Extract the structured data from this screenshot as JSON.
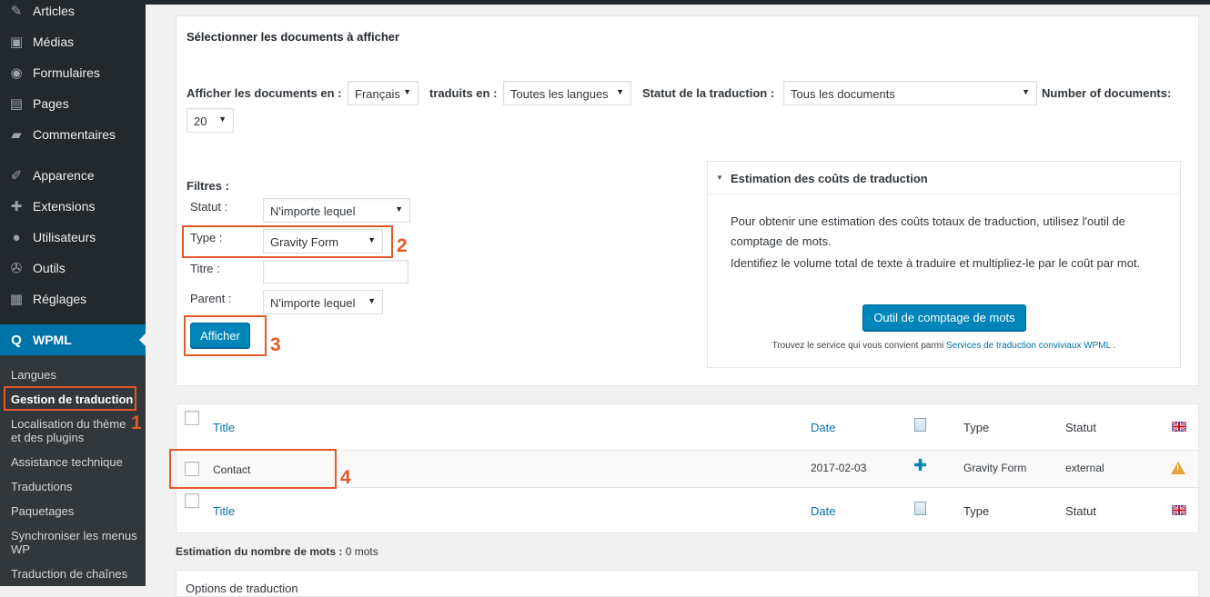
{
  "sidebar": {
    "items": [
      {
        "label": "Articles",
        "icon": "pin-icon"
      },
      {
        "label": "Médias",
        "icon": "media-icon"
      },
      {
        "label": "Formulaires",
        "icon": "forms-icon"
      },
      {
        "label": "Pages",
        "icon": "pages-icon"
      },
      {
        "label": "Commentaires",
        "icon": "comments-icon"
      },
      {
        "label": "Apparence",
        "icon": "brush-icon"
      },
      {
        "label": "Extensions",
        "icon": "plugins-icon"
      },
      {
        "label": "Utilisateurs",
        "icon": "users-icon"
      },
      {
        "label": "Outils",
        "icon": "tools-icon"
      },
      {
        "label": "Réglages",
        "icon": "settings-icon"
      }
    ],
    "active": {
      "label": "WPML",
      "icon": "wpml-icon"
    },
    "submenu": [
      "Langues",
      "Gestion de traduction",
      "Localisation du thème et des plugins",
      "Assistance technique",
      "Traductions",
      "Paquetages",
      "Synchroniser les menus WP",
      "Traduction de chaînes"
    ]
  },
  "annotations": [
    "1",
    "2",
    "3",
    "4"
  ],
  "filters": {
    "section_title": "Sélectionner les documents à afficher",
    "show_docs_label": "Afficher les documents en :",
    "show_docs_value": "Français",
    "translated_label": "traduits en :",
    "translated_value": "Toutes les langues",
    "status_label": "Statut de la traduction :",
    "status_value": "Tous les documents",
    "number_label": "Number of documents:",
    "number_value": "20",
    "filters_label": "Filtres :",
    "statut_label": "Statut :",
    "statut_value": "N'importe lequel",
    "type_label": "Type :",
    "type_value": "Gravity Form",
    "titre_label": "Titre :",
    "titre_value": "",
    "parent_label": "Parent :",
    "parent_value": "N'importe lequel",
    "submit_label": "Afficher"
  },
  "estimate": {
    "title": "Estimation des coûts de traduction",
    "p1": "Pour obtenir une estimation des coûts totaux de traduction, utilisez l'outil de comptage de mots.",
    "p2": "Identifiez le volume total de texte à traduire et multipliez-le par le coût par mot.",
    "button_label": "Outil de comptage de mots",
    "footer_text": "Trouvez le service qui vous convient parmi",
    "footer_link": "Services de traduction conviviaux WPML",
    "footer_end": "."
  },
  "table": {
    "columns": {
      "title": "Title",
      "date": "Date",
      "type": "Type",
      "status": "Statut"
    },
    "rows": [
      {
        "title": "Contact",
        "date": "2017-02-03",
        "type": "Gravity Form",
        "status": "external"
      }
    ]
  },
  "word_count": {
    "label": "Estimation du nombre de mots :",
    "value": "0 mots"
  },
  "options": {
    "title": "Options de traduction"
  }
}
